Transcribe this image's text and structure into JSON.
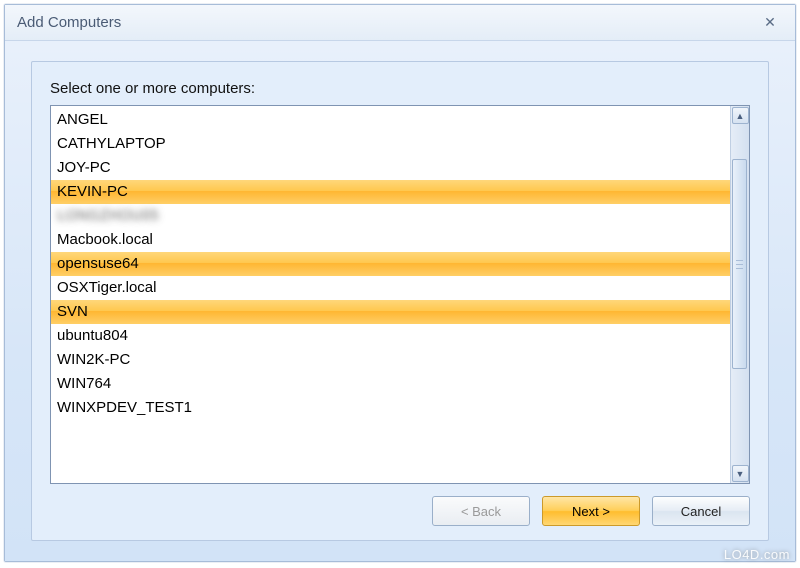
{
  "window": {
    "title": "Add Computers",
    "close_glyph": "✕"
  },
  "prompt": "Select one or more computers:",
  "computers": [
    {
      "name": "ANGEL",
      "selected": false,
      "blurred": false
    },
    {
      "name": "CATHYLAPTOP",
      "selected": false,
      "blurred": false
    },
    {
      "name": "JOY-PC",
      "selected": false,
      "blurred": false
    },
    {
      "name": "KEVIN-PC",
      "selected": true,
      "blurred": false
    },
    {
      "name": "LONGZHOU05",
      "selected": false,
      "blurred": true
    },
    {
      "name": "Macbook.local",
      "selected": false,
      "blurred": false
    },
    {
      "name": "opensuse64",
      "selected": true,
      "blurred": false
    },
    {
      "name": "OSXTiger.local",
      "selected": false,
      "blurred": false
    },
    {
      "name": "SVN",
      "selected": true,
      "blurred": false
    },
    {
      "name": "ubuntu804",
      "selected": false,
      "blurred": false
    },
    {
      "name": "WIN2K-PC",
      "selected": false,
      "blurred": false
    },
    {
      "name": "WIN764",
      "selected": false,
      "blurred": false
    },
    {
      "name": "WINXPDEV_TEST1",
      "selected": false,
      "blurred": false
    }
  ],
  "scrollbar": {
    "up_glyph": "▲",
    "down_glyph": "▼",
    "thumb_top_pct": 10,
    "thumb_height_pct": 62
  },
  "buttons": {
    "back": "< Back",
    "next": "Next >",
    "cancel": "Cancel"
  },
  "watermark": "LO4D.com"
}
